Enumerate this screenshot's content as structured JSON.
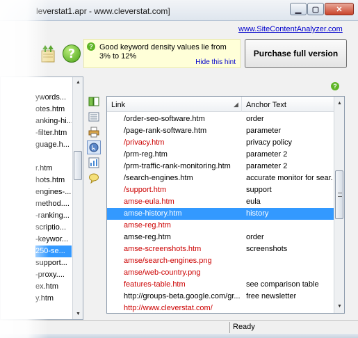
{
  "window": {
    "title": "leverstat1.apr - www.cleverstat.com]",
    "min_glyph": "▁",
    "max_glyph": "▢",
    "close_glyph": "✕"
  },
  "toplink": "www.SiteContentAnalyzer.com",
  "hint": {
    "qmark": "?",
    "text": "Good keyword density values lie from 3% to 12%",
    "hide_label": "Hide this hint"
  },
  "purchase_label": "Purchase full version",
  "help_qmark": "?",
  "tree": {
    "items": [
      {
        "label": "ywords..."
      },
      {
        "label": "otes.htm"
      },
      {
        "label": "anking-hi..."
      },
      {
        "label": "-filter.htm"
      },
      {
        "label": "guage.h..."
      },
      {
        "label": ""
      },
      {
        "label": "r.htm"
      },
      {
        "label": "hots.htm"
      },
      {
        "label": "engines-..."
      },
      {
        "label": "method...."
      },
      {
        "label": "-ranking..."
      },
      {
        "label": "scriptio..."
      },
      {
        "label": "-keywor..."
      },
      {
        "label": "250-se..."
      },
      {
        "label": "support..."
      },
      {
        "label": "-proxy...."
      },
      {
        "label": "ex.htm"
      },
      {
        "label": "y.htm"
      }
    ],
    "up_glyph": "▲",
    "down_glyph": "▼"
  },
  "grid": {
    "columns": [
      "Link",
      "Anchor Text"
    ],
    "sort_glyph": "◢",
    "up_glyph": "▲",
    "down_glyph": "▼",
    "rows": [
      {
        "link": "/order-seo-software.htm",
        "anchor": "order",
        "red": false
      },
      {
        "link": "/page-rank-software.htm",
        "anchor": "parameter",
        "red": false
      },
      {
        "link": "/privacy.htm",
        "anchor": "privacy policy",
        "red": true
      },
      {
        "link": "/prm-reg.htm",
        "anchor": "parameter 2",
        "red": false
      },
      {
        "link": "/prm-traffic-rank-monitoring.htm",
        "anchor": "parameter 2",
        "red": false
      },
      {
        "link": "/search-engines.htm",
        "anchor": "accurate monitor for sear...",
        "red": false
      },
      {
        "link": "/support.htm",
        "anchor": "support",
        "red": true
      },
      {
        "link": "amse-eula.htm",
        "anchor": "eula",
        "red": true
      },
      {
        "link": "amse-history.htm",
        "anchor": "history",
        "red": true,
        "selected": true
      },
      {
        "link": "amse-reg.htm",
        "anchor": "",
        "red": true
      },
      {
        "link": "amse-reg.htm",
        "anchor": "order",
        "red": false
      },
      {
        "link": "amse-screenshots.htm",
        "anchor": "screenshots",
        "red": true
      },
      {
        "link": "amse/search-engines.png",
        "anchor": "",
        "red": true
      },
      {
        "link": "amse/web-country.png",
        "anchor": "",
        "red": true
      },
      {
        "link": "features-table.htm",
        "anchor": "see comparison table",
        "red": true
      },
      {
        "link": "http://groups-beta.google.com/gr...",
        "anchor": "free newsletter",
        "red": false
      },
      {
        "link": "http://www.cleverstat.com/",
        "anchor": "",
        "red": true
      }
    ]
  },
  "status": "Ready"
}
